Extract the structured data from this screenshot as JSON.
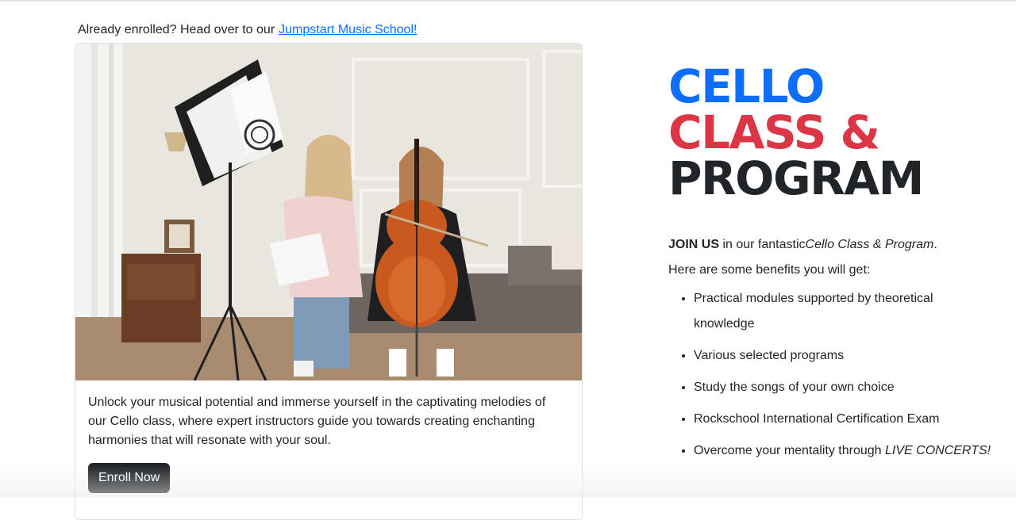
{
  "enrolled": {
    "prefix": "Already enrolled? Head over to our",
    "link_label": "Jumpstart Music School!"
  },
  "card": {
    "photo_icon": "photo-cello-lesson",
    "description": "Unlock your musical potential and immerse yourself in the captivating melodies of our Cello class, where expert instructors guide you towards creating enchanting harmonies that will resonate with your soul.",
    "button_label": "Enroll Now"
  },
  "headline": {
    "line1": "CELLO",
    "line2": "CLASS &",
    "line3": "PROGRAM"
  },
  "intro": {
    "join": "JOIN US",
    "middle": " in our fantastic",
    "program_name": "Cello Class & Program",
    "end": ".",
    "benefits_lead": "Here are some benefits you will get:"
  },
  "benefits": [
    "Practical modules supported by theoretical knowledge",
    "Various selected programs",
    "Study the songs of your own choice",
    "Rockschool International Certification Exam"
  ],
  "benefit_last": {
    "prefix": "Overcome your mentality through ",
    "emphasis": "LIVE CONCERTS!"
  },
  "colors": {
    "link": "#0d6efd",
    "headline_blue": "#0d6efd",
    "headline_red": "#dc3545",
    "headline_dark": "#212529",
    "button_bg": "#212529"
  }
}
